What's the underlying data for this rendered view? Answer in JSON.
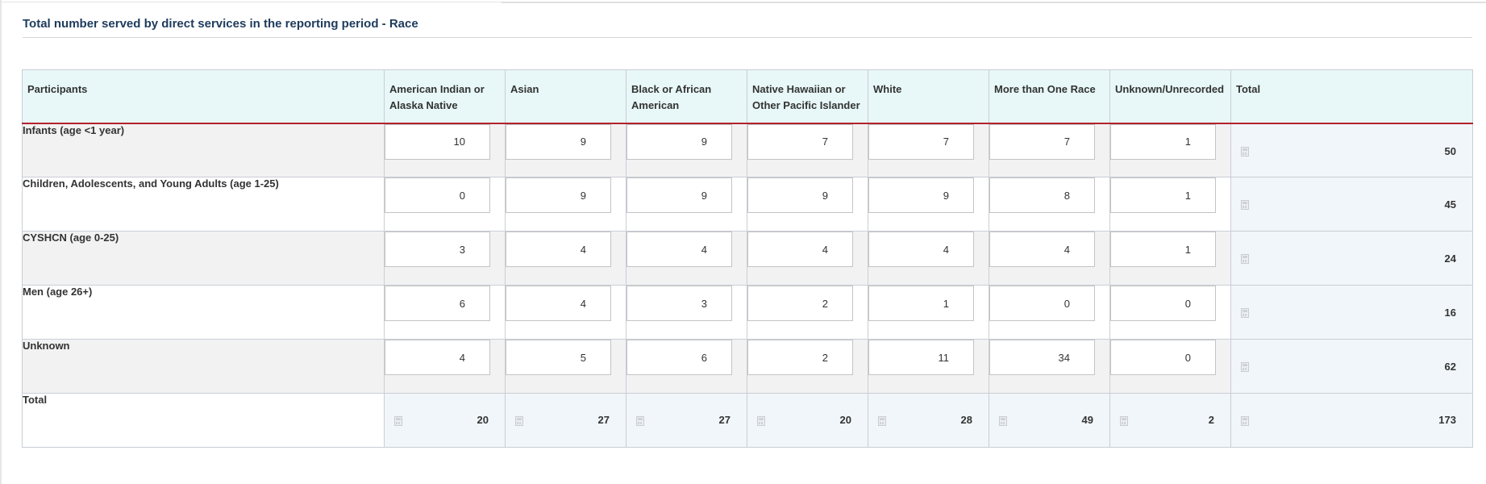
{
  "section": {
    "title": "Total number served by direct services in the reporting period - Race"
  },
  "table": {
    "headers": [
      "Participants",
      "American Indian or Alaska Native",
      "Asian",
      "Black or African American",
      "Native Hawaiian or Other Pacific Islander",
      "White",
      "More than One Race",
      "Unknown/Unrecorded",
      "Total"
    ],
    "rows": [
      {
        "label": "Infants (age <1 year)",
        "values": [
          "10",
          "9",
          "9",
          "7",
          "7",
          "7",
          "1"
        ],
        "total": "50"
      },
      {
        "label": "Children, Adolescents, and Young Adults (age 1-25)",
        "values": [
          "0",
          "9",
          "9",
          "9",
          "9",
          "8",
          "1"
        ],
        "total": "45"
      },
      {
        "label": "CYSHCN (age 0-25)",
        "values": [
          "3",
          "4",
          "4",
          "4",
          "4",
          "4",
          "1"
        ],
        "total": "24"
      },
      {
        "label": "Men (age 26+)",
        "values": [
          "6",
          "4",
          "3",
          "2",
          "1",
          "0",
          "0"
        ],
        "total": "16"
      },
      {
        "label": "Unknown",
        "values": [
          "4",
          "5",
          "6",
          "2",
          "11",
          "34",
          "0"
        ],
        "total": "62"
      }
    ],
    "totals": {
      "label": "Total",
      "values": [
        "20",
        "27",
        "27",
        "20",
        "28",
        "49",
        "2"
      ],
      "grand_total": "173"
    }
  },
  "icons": {
    "calculated": "calculator-icon"
  }
}
